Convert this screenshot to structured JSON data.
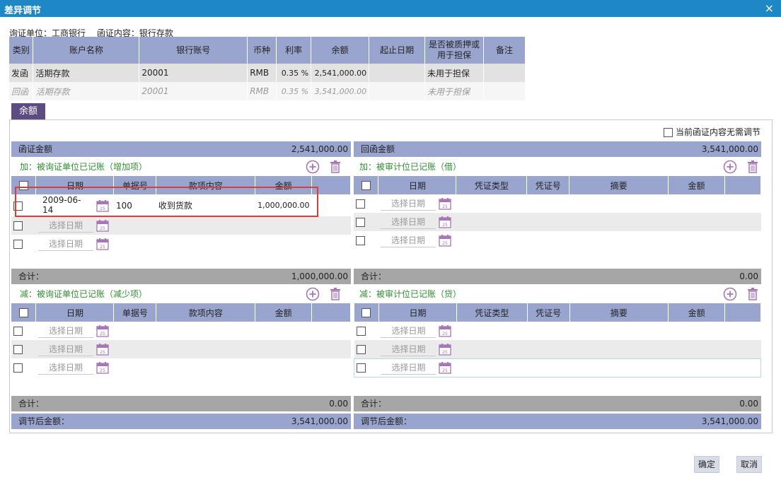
{
  "window": {
    "title": "差异调节",
    "close_glyph": "×"
  },
  "info": {
    "unit": "询证单位：工商银行",
    "content": "函证内容：银行存款"
  },
  "account_table": {
    "headers": [
      "类别",
      "账户名称",
      "银行账号",
      "币种",
      "利率",
      "余额",
      "起止日期",
      "是否被质押或用于担保",
      "备注"
    ],
    "rows": [
      {
        "type": "发函",
        "name": "活期存款",
        "account": "20001",
        "currency": "RMB",
        "rate": "0.35 %",
        "balance": "2,541,000.00",
        "period": "",
        "pledge": "未用于担保",
        "note": ""
      },
      {
        "type": "回函",
        "name": "活期存款",
        "account": "20001",
        "currency": "RMB",
        "rate": "0.35 %",
        "balance": "3,541,000.00",
        "period": "",
        "pledge": "未用于担保",
        "note": ""
      }
    ]
  },
  "tab": {
    "label": "余额"
  },
  "no_adjust": {
    "label": "当前函证内容无需调节"
  },
  "left": {
    "header_label": "函证金额",
    "header_value": "2,541,000.00",
    "add_title": "加：被询证单位已记账（增加项）",
    "add_headers": [
      "日期",
      "单据号",
      "款项内容",
      "金额"
    ],
    "add_rows": [
      {
        "date": "2009-06-14",
        "doc": "100",
        "content": "收到货款",
        "amount": "1,000,000.00"
      },
      {
        "date": "",
        "doc": "",
        "content": "",
        "amount": ""
      },
      {
        "date": "",
        "doc": "",
        "content": "",
        "amount": ""
      }
    ],
    "add_total_label": "合计：",
    "add_total": "1,000,000.00",
    "sub_title": "减：被询证单位已记账（减少项）",
    "sub_headers": [
      "日期",
      "单据号",
      "款项内容",
      "金额"
    ],
    "sub_rows": [
      {
        "date": "",
        "doc": "",
        "content": "",
        "amount": ""
      },
      {
        "date": "",
        "doc": "",
        "content": "",
        "amount": ""
      },
      {
        "date": "",
        "doc": "",
        "content": "",
        "amount": ""
      }
    ],
    "sub_total_label": "合计：",
    "sub_total": "0.00",
    "adjusted_label": "调节后金额：",
    "adjusted_value": "3,541,000.00"
  },
  "right": {
    "header_label": "回函金额",
    "header_value": "3,541,000.00",
    "add_title": "加：被审计位已记账（借）",
    "add_headers": [
      "日期",
      "凭证类型",
      "凭证号",
      "摘要",
      "金额"
    ],
    "add_total_label": "合计：",
    "add_total": "0.00",
    "sub_title": "减：被审计位已记账（贷）",
    "sub_headers": [
      "日期",
      "凭证类型",
      "凭证号",
      "摘要",
      "金额"
    ],
    "sub_total_label": "合计：",
    "sub_total": "0.00",
    "adjusted_label": "调节后金额：",
    "adjusted_value": "3,541,000.00"
  },
  "date_placeholder": "选择日期",
  "calendar_day": "25",
  "buttons": {
    "ok": "确定",
    "cancel": "取消"
  },
  "colors": {
    "titlebar": "#1e88c7",
    "header": "#9aa5cf",
    "tab": "#5d4c82",
    "icon": "#a676b8",
    "highlight": "#e8392f",
    "section_text": "#2f8f2f"
  }
}
